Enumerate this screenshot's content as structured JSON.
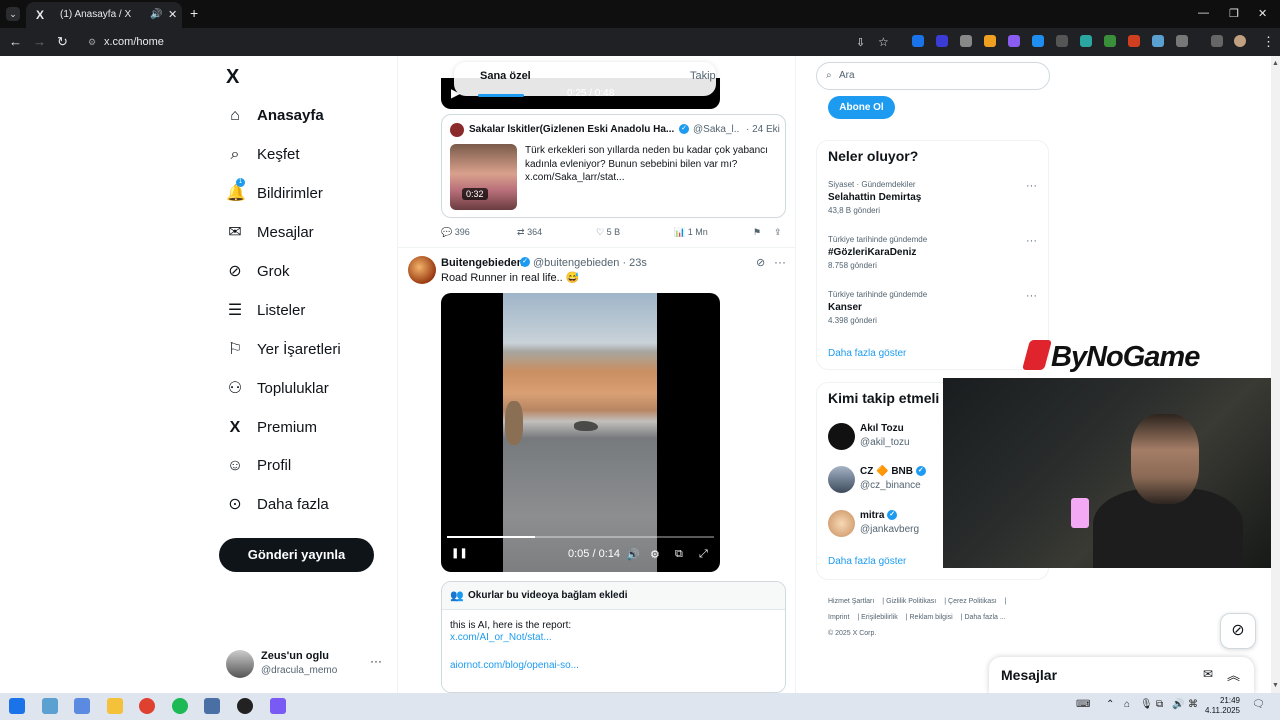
{
  "browser": {
    "tab_title": "(1) Anasayfa / X",
    "tab_favicon": "X",
    "url": "x.com/home",
    "tab_list_icon": "⌄",
    "speaker_icon": "🔊",
    "close_icon": "✕",
    "new_tab_icon": "+",
    "minimize": "—",
    "maximize": "❐",
    "close": "✕",
    "back": "←",
    "forward": "→",
    "reload": "↻",
    "site_info": "⚙",
    "install": "⇩",
    "bookmark": "☆",
    "menu": "⋮"
  },
  "sidebar": {
    "logo": "X",
    "items": [
      {
        "label": "Anasayfa",
        "icon": "home-icon",
        "glyph": "⌂"
      },
      {
        "label": "Keşfet",
        "icon": "search-icon",
        "glyph": "⌕"
      },
      {
        "label": "Bildirimler",
        "icon": "bell-icon",
        "glyph": "🔔",
        "badge": "1"
      },
      {
        "label": "Mesajlar",
        "icon": "mail-icon",
        "glyph": "✉"
      },
      {
        "label": "Grok",
        "icon": "grok-icon",
        "glyph": "⊘"
      },
      {
        "label": "Listeler",
        "icon": "list-icon",
        "glyph": "☰"
      },
      {
        "label": "Yer İşaretleri",
        "icon": "bookmark-icon",
        "glyph": "⚐"
      },
      {
        "label": "Topluluklar",
        "icon": "communities-icon",
        "glyph": "⚇"
      },
      {
        "label": "Premium",
        "icon": "x-premium-icon",
        "glyph": "X"
      },
      {
        "label": "Profil",
        "icon": "profile-icon",
        "glyph": "☺"
      },
      {
        "label": "Daha fazla",
        "icon": "more-circle-icon",
        "glyph": "⊙"
      }
    ],
    "post_button": "Gönderi yayınla",
    "account": {
      "name": "Zeus'un oglu",
      "handle": "@dracula_memo",
      "more": "···"
    }
  },
  "feed": {
    "tabs": [
      "Sana özel",
      "Takip"
    ],
    "top_video_time": "0:25 / 0:48",
    "quote": {
      "name": "Sakalar İskitler(Gizlenen Eski Anadolu Ha...",
      "verified": "✓",
      "handle": "@Saka_l...",
      "date": "· 24 Eki",
      "duration": "0:32",
      "text": "Türk erkekleri son yıllarda neden bu kadar çok yabancı kadınla evleniyor? Bunun sebebini bilen var mı? x.com/Saka_larr/stat..."
    },
    "actions": {
      "replies": "396",
      "reposts": "364",
      "likes": "5 B",
      "views": "1 Mn"
    },
    "action_icons": {
      "reply": "💬",
      "repost": "⇄",
      "like": "♡",
      "views": "📊",
      "bookmark": "⚑",
      "share": "⇪"
    },
    "post": {
      "name": "Buitengebieden",
      "verified": "✓",
      "handle": "@buitengebieden · 23s",
      "grok": "⊘",
      "more": "···",
      "text": "Road Runner in real life.. 😅",
      "video_time": "0:05 / 0:14",
      "video_progress": 0.33,
      "video_controls": {
        "pause": "❚❚",
        "volume": "🔊",
        "settings": "⚙",
        "pip": "⧉",
        "fullscreen": "⤢"
      }
    },
    "note": {
      "header": "Okurlar bu videoya bağlam ekledi",
      "line1": "this is AI, here is the report:",
      "link1": "x.com/AI_or_Not/stat...",
      "link2": "aiornot.com/blog/openai-so..."
    }
  },
  "right": {
    "search_placeholder": "Ara",
    "search_icon": "⌕",
    "subscribe": "Abone Ol",
    "trends_title": "Neler oluyor?",
    "trends": [
      {
        "context": "Siyaset · Gündemdekiler",
        "name": "Selahattin Demirtaş",
        "posts": "43,8 B gönderi"
      },
      {
        "context": "Türkiye tarihinde gündemde",
        "name": "#GözleriKaraDeniz",
        "posts": "8.758 gönderi"
      },
      {
        "context": "Türkiye tarihinde gündemde",
        "name": "Kanser",
        "posts": "4.398 gönderi"
      }
    ],
    "trend_more": "···",
    "show_more": "Daha fazla göster",
    "who_title": "Kimi takip etmeli",
    "who": [
      {
        "name": "Akıl Tozu",
        "handle": "@akil_tozu"
      },
      {
        "name": "CZ 🔶 BNB",
        "handle": "@cz_binance"
      },
      {
        "name": "mitra",
        "handle": "@jankavberg"
      }
    ],
    "who_more": "Daha fazla göster",
    "footer": [
      "Hizmet Şartları",
      "Gizlilik Politikası",
      "Çerez Politikası",
      "Imprint",
      "Erişilebilirlik",
      "Reklam bilgisi",
      "Daha fazla ...",
      "© 2025 X Corp."
    ]
  },
  "overlay": {
    "logo": "ByNoGame"
  },
  "messages": {
    "title": "Mesajlar",
    "new_icon": "✉",
    "collapse_icon": "︽"
  },
  "grok_fab": "⊘",
  "taskbar": {
    "time": "21:49",
    "date": "4.11.2025"
  }
}
